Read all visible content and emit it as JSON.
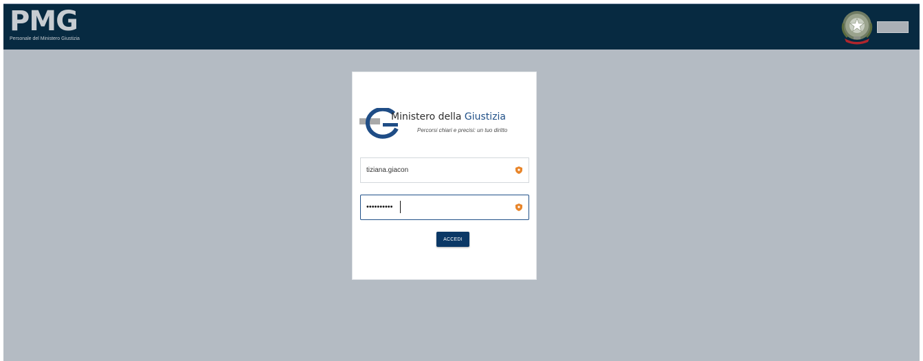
{
  "header": {
    "brand_title": "PMG",
    "brand_subtitle": "Personale del Ministero Giustizia",
    "emblem_icon": "italian-republic-emblem-icon",
    "background": "#072a41"
  },
  "login_card": {
    "logo": {
      "initial": "G",
      "name_part1": "Ministero della ",
      "name_part2": "Giustizia",
      "tagline": "Percorsi chiari e precisi: un tuo diritto"
    },
    "username": {
      "value": "tiziana.giacon",
      "icon": "shield-icon"
    },
    "password": {
      "masked_value": "••••••••••",
      "icon": "shield-icon"
    },
    "submit_label": "ACCEDI"
  },
  "colors": {
    "page_background": "#b4bbc3",
    "accent_blue": "#0b3866",
    "shield_orange": "#e8852a"
  }
}
